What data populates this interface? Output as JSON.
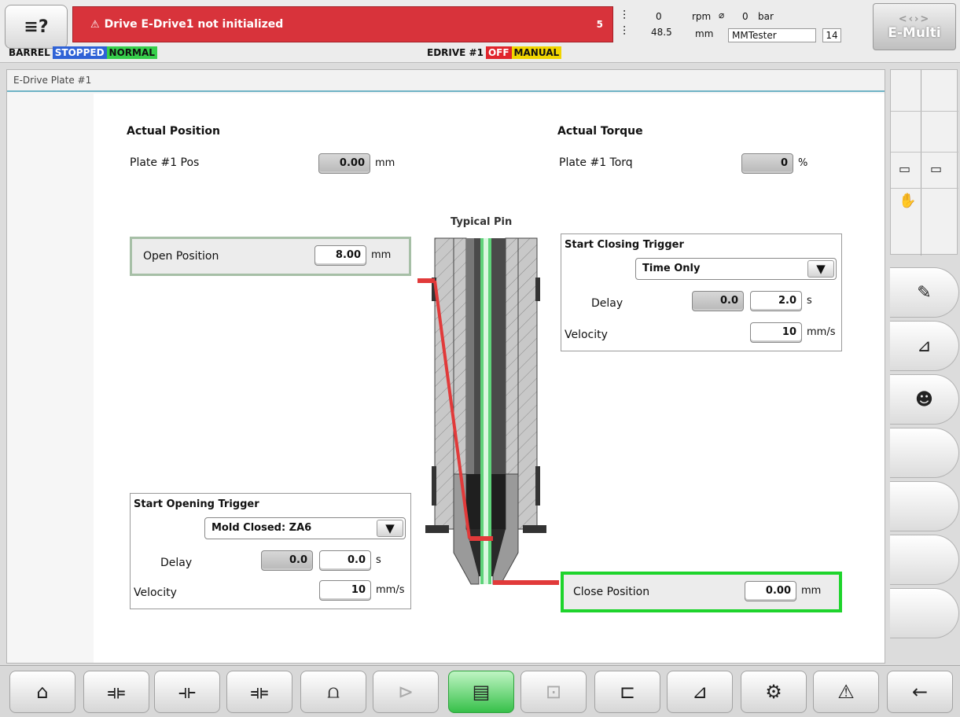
{
  "topbar": {
    "alarm_text": "Drive E-Drive1 not initialized",
    "alarm_count": "5",
    "status": {
      "barrel": "BARREL",
      "stopped": "STOPPED",
      "normal": "NORMAL"
    },
    "edrive": {
      "label": "EDRIVE #1",
      "off": "OFF",
      "manual": "MANUAL"
    },
    "readouts": {
      "rpm_value": "0",
      "rpm_unit": "rpm",
      "bar_value": "0",
      "bar_unit": "bar",
      "mm_value": "48.5",
      "mm_unit": "mm",
      "user": "MMTester",
      "user_num": "14"
    },
    "brand": "E-Multi"
  },
  "panel": {
    "title": "E-Drive Plate #1",
    "actual_position": {
      "heading": "Actual Position",
      "label": "Plate #1 Pos",
      "value": "0.00",
      "unit": "mm"
    },
    "actual_torque": {
      "heading": "Actual Torque",
      "label": "Plate #1 Torq",
      "value": "0",
      "unit": "%"
    },
    "open_position": {
      "label": "Open Position",
      "value": "8.00",
      "unit": "mm"
    },
    "close_position": {
      "label": "Close Position",
      "value": "0.00",
      "unit": "mm"
    },
    "diagram_title": "Typical Pin",
    "closing_trigger": {
      "heading": "Start Closing Trigger",
      "mode": "Time Only",
      "delay_label": "Delay",
      "delay_actual": "0.0",
      "delay_set": "2.0",
      "delay_unit": "s",
      "velocity_label": "Velocity",
      "velocity": "10",
      "velocity_unit": "mm/s"
    },
    "opening_trigger": {
      "heading": "Start Opening Trigger",
      "mode": "Mold Closed: ZA6",
      "delay_label": "Delay",
      "delay_actual": "0.0",
      "delay_set": "0.0",
      "delay_unit": "s",
      "velocity_label": "Velocity",
      "velocity": "10",
      "velocity_unit": "mm/s"
    }
  },
  "colors": {
    "alarm": "#d8333b",
    "stopped": "#2f62d6",
    "normal": "#36cf4b",
    "off": "#e0252c",
    "manual": "#f0d400",
    "close_border": "#1ed42c",
    "active_tab": "#37c04a",
    "pin_line": "#e13a3a"
  },
  "icons": {
    "left": [
      "cycle-icon",
      "hand-icon",
      "gear-clamp-icon",
      "auto-cycle-icon",
      "blank",
      "inject-left-icon",
      "inject-left-icon",
      "blank",
      "info-gear-icon",
      "list-icon"
    ],
    "right": [
      "notes-icon",
      "chart-person-icon",
      "operator-icon"
    ],
    "bottom": [
      "home-icon",
      "mold-icon",
      "mold-open-icon",
      "mold-close-icon",
      "heater-icon",
      "injection-icon",
      "list-icon",
      "core-icon",
      "ejector-icon",
      "graph-icon",
      "settings-icon",
      "warning-icon",
      "back-arrow-icon"
    ]
  }
}
